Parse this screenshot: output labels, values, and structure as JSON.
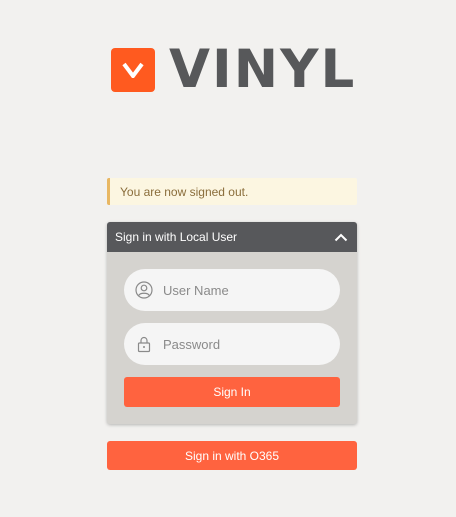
{
  "logo": {
    "mark_letter": "v",
    "text": "VINYL",
    "mark_color": "#ff5a1f"
  },
  "alert": {
    "message": "You are now signed out."
  },
  "login_panel": {
    "header_title": "Sign in with Local User",
    "username": {
      "placeholder": "User Name",
      "value": ""
    },
    "password": {
      "placeholder": "Password",
      "value": ""
    },
    "signin_label": "Sign In"
  },
  "o365_button": {
    "label": "Sign in with O365"
  },
  "colors": {
    "accent": "#ff633f",
    "header": "#57585b",
    "background": "#f2f1ef"
  },
  "icons": [
    "user-icon",
    "lock-icon",
    "chevron-up-icon"
  ]
}
